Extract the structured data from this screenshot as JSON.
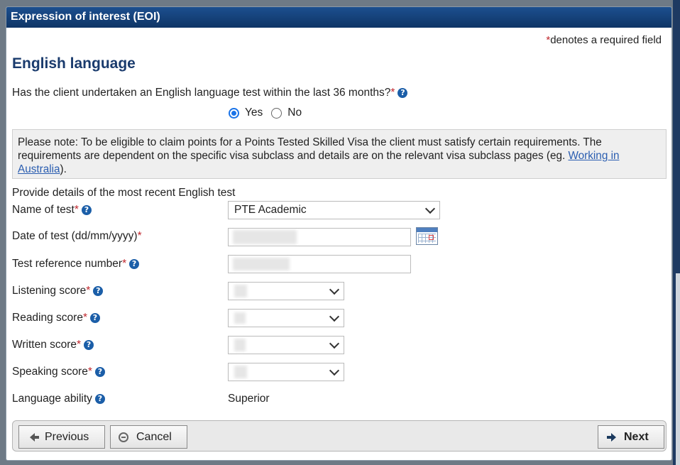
{
  "dialog": {
    "title": "Expression of interest (EOI)"
  },
  "required_note": {
    "star": "*",
    "text": "denotes a required field"
  },
  "section_title": "English language",
  "question": {
    "text": "Has the client undertaken an English language test within the last 36 months?",
    "star": "*"
  },
  "radio": {
    "yes_label": "Yes",
    "no_label": "No",
    "selected": "Yes"
  },
  "note": {
    "text": "Please note: To be eligible to claim points for a Points Tested Skilled Visa the client must satisfy certain requirements. The requirements are dependent on the specific visa subclass and details are on the relevant visa subclass pages (eg. ",
    "link": "Working in Australia",
    "after": ")."
  },
  "provide_details": "Provide details of the most recent English test",
  "fields": {
    "test_name": {
      "label": "Name of test",
      "star": "*",
      "value": "PTE Academic"
    },
    "test_date": {
      "label": "Date of test (dd/mm/yyyy)",
      "star": "*",
      "value": ""
    },
    "reference": {
      "label": "Test reference number",
      "star": "*",
      "value": ""
    },
    "listening": {
      "label": "Listening score",
      "star": "*",
      "value": ""
    },
    "reading": {
      "label": "Reading score",
      "star": "*",
      "value": ""
    },
    "written": {
      "label": "Written score",
      "star": "*",
      "value": ""
    },
    "speaking": {
      "label": "Speaking score",
      "star": "*",
      "value": ""
    },
    "ability": {
      "label": "Language ability",
      "value": "Superior"
    }
  },
  "help_glyph": "?",
  "buttons": {
    "previous": "Previous",
    "cancel": "Cancel",
    "next": "Next"
  },
  "icons": [
    "help-icon",
    "calendar-icon",
    "arrow-left-icon",
    "cancel-circle-icon",
    "arrow-right-icon",
    "chevron-down-icon"
  ],
  "colors": {
    "title_bar": "#1c4f8f",
    "heading": "#1a3b6d",
    "required": "#c0272d",
    "link": "#2a5db0"
  }
}
